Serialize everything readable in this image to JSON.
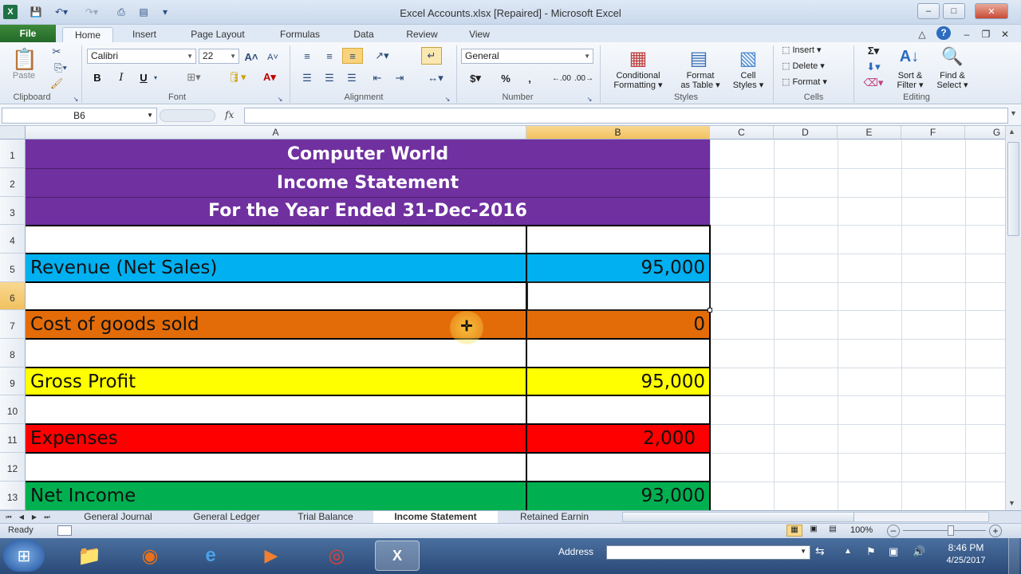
{
  "window": {
    "title": "Excel Accounts.xlsx [Repaired] - Microsoft Excel"
  },
  "tabs": [
    "File",
    "Home",
    "Insert",
    "Page Layout",
    "Formulas",
    "Data",
    "Review",
    "View"
  ],
  "ribbon": {
    "clipboard": {
      "paste": "Paste",
      "label": "Clipboard"
    },
    "font": {
      "name": "Calibri",
      "size": "22",
      "label": "Font",
      "bold": "B",
      "italic": "I",
      "underline": "U"
    },
    "alignment": {
      "label": "Alignment"
    },
    "number": {
      "format": "General",
      "label": "Number",
      "currency": "$",
      "percent": "%",
      "comma": ",",
      "inc_decimal": ".00",
      "dec_decimal": ".00"
    },
    "styles": {
      "conditional": [
        "Conditional",
        "Formatting"
      ],
      "format_table": [
        "Format",
        "as Table"
      ],
      "cell_styles": [
        "Cell",
        "Styles"
      ],
      "label": "Styles"
    },
    "cells": {
      "insert": "Insert",
      "delete": "Delete",
      "format": "Format",
      "label": "Cells"
    },
    "editing": {
      "sort": [
        "Sort &",
        "Filter"
      ],
      "find": [
        "Find &",
        "Select"
      ],
      "label": "Editing"
    }
  },
  "formula_bar": {
    "name_box": "B6",
    "fx": "fx",
    "value": ""
  },
  "columns": [
    "A",
    "B",
    "C",
    "D",
    "E",
    "F",
    "G"
  ],
  "rows": [
    "1",
    "2",
    "3",
    "4",
    "5",
    "6",
    "7",
    "8",
    "9",
    "10",
    "11",
    "12",
    "13"
  ],
  "sheet": {
    "title1": "Computer World",
    "title2": "Income Statement",
    "title3": "For the Year Ended 31-Dec-2016",
    "items": [
      {
        "label": "Revenue (Net Sales)",
        "value": "95,000",
        "color": "#00b0f0"
      },
      {
        "label": "Cost of goods sold",
        "value": "0",
        "color": "#e36c09"
      },
      {
        "label": "Gross Profit",
        "value": "95,000",
        "color": "#ffff00"
      },
      {
        "label": "Expenses",
        "value": "2,000",
        "color": "#ff0000"
      },
      {
        "label": "Net Income",
        "value": "93,000",
        "color": "#00b050"
      }
    ],
    "banner_color": "#7030a0"
  },
  "sheet_tabs": [
    "General Journal",
    "General Ledger",
    "Trial Balance",
    "Income Statement",
    "Retained Earnin"
  ],
  "status": {
    "ready": "Ready",
    "zoom": "100%"
  },
  "taskbar": {
    "address_label": "Address",
    "time": "8:46 PM",
    "date": "4/25/2017"
  }
}
